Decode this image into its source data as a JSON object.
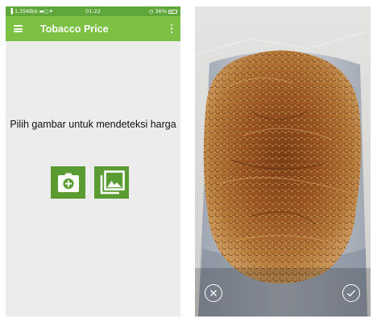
{
  "status_bar": {
    "left_text": "1,35KB/s",
    "time": "01:22",
    "battery": "36%"
  },
  "app_bar": {
    "title": "Tobacco Price",
    "menu_icon": "hamburger-menu-icon",
    "overflow_icon": "more-vert-icon"
  },
  "main": {
    "prompt": "Pilih gambar untuk mendeteksi harga",
    "camera_icon": "add-a-photo-icon",
    "gallery_icon": "photo-library-icon"
  },
  "preview": {
    "cancel_icon": "close-icon",
    "confirm_icon": "check-icon"
  },
  "colors": {
    "app_bar": "#7cc143",
    "status_bar": "#5fa73a",
    "buttons": "#5a9b32",
    "background": "#ececec"
  }
}
